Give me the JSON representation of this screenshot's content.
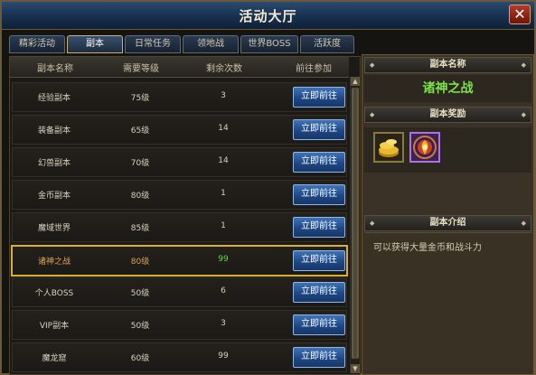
{
  "window": {
    "title": "活动大厅",
    "close_label": "✕"
  },
  "tabs": [
    {
      "label": "精彩活动",
      "active": false
    },
    {
      "label": "副本",
      "active": true
    },
    {
      "label": "日常任务",
      "active": false
    },
    {
      "label": "领地战",
      "active": false
    },
    {
      "label": "世界BOSS",
      "active": false
    },
    {
      "label": "活跃度",
      "active": false
    }
  ],
  "table": {
    "headers": [
      "副本名称",
      "需要等级",
      "剩余次数",
      "前往参加"
    ],
    "rows": [
      {
        "name": "经验副本",
        "level": "75级",
        "count": "3",
        "button": "立即前往",
        "selected": false
      },
      {
        "name": "装备副本",
        "level": "65级",
        "count": "14",
        "button": "立即前往",
        "selected": false
      },
      {
        "name": "幻兽副本",
        "level": "70级",
        "count": "14",
        "button": "立即前往",
        "selected": false
      },
      {
        "name": "金币副本",
        "level": "80级",
        "count": "1",
        "button": "立即前往",
        "selected": false
      },
      {
        "name": "魔域世界",
        "level": "85级",
        "count": "1",
        "button": "立即前往",
        "selected": false
      },
      {
        "name": "诸神之战",
        "level": "80级",
        "count": "99",
        "button": "立即前往",
        "selected": true
      },
      {
        "name": "个人BOSS",
        "level": "50级",
        "count": "6",
        "button": "立即前往",
        "selected": false
      },
      {
        "name": "VIP副本",
        "level": "50级",
        "count": "3",
        "button": "立即前往",
        "selected": false
      },
      {
        "name": "魔龙窟",
        "level": "60级",
        "count": "99",
        "button": "立即前往",
        "selected": false
      }
    ]
  },
  "side": {
    "name_header": "副本名称",
    "selected_name": "诸神之战",
    "rewards_header": "副本奖励",
    "rewards": [
      {
        "icon": "gold-coins-icon"
      },
      {
        "icon": "flame-medallion-icon"
      }
    ],
    "intro_header": "副本介绍",
    "intro_text": "可以获得大量金币和战斗力"
  },
  "colors": {
    "accent_blue": "#1d4580",
    "highlight_gold": "#d8b22c",
    "green_text": "#55e03a",
    "name_green": "#7ee04a"
  }
}
